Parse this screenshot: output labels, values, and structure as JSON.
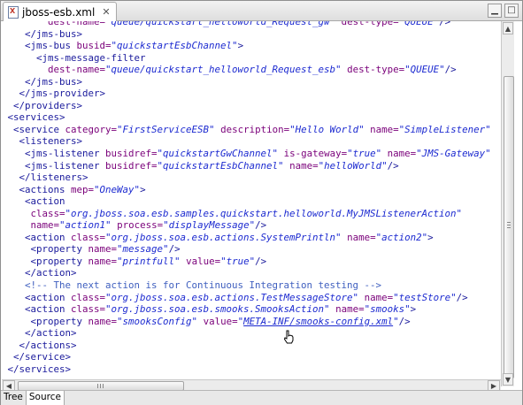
{
  "tab": {
    "title": "jboss-esb.xml",
    "close_glyph": "✕"
  },
  "window_buttons": {
    "minimize": "▁",
    "maximize": "□"
  },
  "bottom_tabs": [
    "Tree",
    "Source"
  ],
  "active_bottom_tab": "Source",
  "code_lines": [
    [
      [
        "t",
        "        "
      ],
      [
        "a",
        "dest-name="
      ],
      [
        "v",
        "\"queue/quickstart_helloworld_Request_gw\""
      ],
      [
        "t",
        " "
      ],
      [
        "a",
        "dest-type="
      ],
      [
        "v",
        "\"QUEUE\""
      ],
      [
        "g",
        "/>"
      ]
    ],
    [
      [
        "t",
        "    "
      ],
      [
        "g",
        "</jms-bus>"
      ]
    ],
    [
      [
        "t",
        "    "
      ],
      [
        "g",
        "<jms-bus "
      ],
      [
        "a",
        "busid="
      ],
      [
        "v",
        "\"quickstartEsbChannel\""
      ],
      [
        "g",
        ">"
      ]
    ],
    [
      [
        "t",
        "      "
      ],
      [
        "g",
        "<jms-message-filter"
      ]
    ],
    [
      [
        "t",
        "        "
      ],
      [
        "a",
        "dest-name="
      ],
      [
        "v",
        "\"queue/quickstart_helloworld_Request_esb\""
      ],
      [
        "t",
        " "
      ],
      [
        "a",
        "dest-type="
      ],
      [
        "v",
        "\"QUEUE\""
      ],
      [
        "g",
        "/>"
      ]
    ],
    [
      [
        "t",
        "    "
      ],
      [
        "g",
        "</jms-bus>"
      ]
    ],
    [
      [
        "t",
        "   "
      ],
      [
        "g",
        "</jms-provider>"
      ]
    ],
    [
      [
        "t",
        "  "
      ],
      [
        "g",
        "</providers>"
      ]
    ],
    [
      [
        "t",
        " "
      ],
      [
        "g",
        "<services>"
      ]
    ],
    [
      [
        "t",
        "  "
      ],
      [
        "g",
        "<service "
      ],
      [
        "a",
        "category="
      ],
      [
        "v",
        "\"FirstServiceESB\""
      ],
      [
        "t",
        " "
      ],
      [
        "a",
        "description="
      ],
      [
        "v",
        "\"Hello World\""
      ],
      [
        "t",
        " "
      ],
      [
        "a",
        "name="
      ],
      [
        "v",
        "\"SimpleListener\""
      ]
    ],
    [
      [
        "t",
        "   "
      ],
      [
        "g",
        "<listeners>"
      ]
    ],
    [
      [
        "t",
        "    "
      ],
      [
        "g",
        "<jms-listener "
      ],
      [
        "a",
        "busidref="
      ],
      [
        "v",
        "\"quickstartGwChannel\""
      ],
      [
        "t",
        " "
      ],
      [
        "a",
        "is-gateway="
      ],
      [
        "v",
        "\"true\""
      ],
      [
        "t",
        " "
      ],
      [
        "a",
        "name="
      ],
      [
        "v",
        "\"JMS-Gateway\""
      ]
    ],
    [
      [
        "t",
        "    "
      ],
      [
        "g",
        "<jms-listener "
      ],
      [
        "a",
        "busidref="
      ],
      [
        "v",
        "\"quickstartEsbChannel\""
      ],
      [
        "t",
        " "
      ],
      [
        "a",
        "name="
      ],
      [
        "v",
        "\"helloWorld\""
      ],
      [
        "g",
        "/>"
      ]
    ],
    [
      [
        "t",
        "   "
      ],
      [
        "g",
        "</listeners>"
      ]
    ],
    [
      [
        "t",
        "   "
      ],
      [
        "g",
        "<actions "
      ],
      [
        "a",
        "mep="
      ],
      [
        "v",
        "\"OneWay\""
      ],
      [
        "g",
        ">"
      ]
    ],
    [
      [
        "t",
        "    "
      ],
      [
        "g",
        "<action"
      ]
    ],
    [
      [
        "t",
        "     "
      ],
      [
        "a",
        "class="
      ],
      [
        "v",
        "\"org.jboss.soa.esb.samples.quickstart.helloworld.MyJMSListenerAction\""
      ]
    ],
    [
      [
        "t",
        "     "
      ],
      [
        "a",
        "name="
      ],
      [
        "v",
        "\"action1\""
      ],
      [
        "t",
        " "
      ],
      [
        "a",
        "process="
      ],
      [
        "v",
        "\"displayMessage\""
      ],
      [
        "g",
        "/>"
      ]
    ],
    [
      [
        "t",
        "    "
      ],
      [
        "g",
        "<action "
      ],
      [
        "a",
        "class="
      ],
      [
        "v",
        "\"org.jboss.soa.esb.actions.SystemPrintln\""
      ],
      [
        "t",
        " "
      ],
      [
        "a",
        "name="
      ],
      [
        "v",
        "\"action2\""
      ],
      [
        "g",
        ">"
      ]
    ],
    [
      [
        "t",
        "     "
      ],
      [
        "g",
        "<property "
      ],
      [
        "a",
        "name="
      ],
      [
        "v",
        "\"message\""
      ],
      [
        "g",
        "/>"
      ]
    ],
    [
      [
        "t",
        "     "
      ],
      [
        "g",
        "<property "
      ],
      [
        "a",
        "name="
      ],
      [
        "v",
        "\"printfull\""
      ],
      [
        "t",
        " "
      ],
      [
        "a",
        "value="
      ],
      [
        "v",
        "\"true\""
      ],
      [
        "g",
        "/>"
      ]
    ],
    [
      [
        "t",
        "    "
      ],
      [
        "g",
        "</action>"
      ]
    ],
    [
      [
        "t",
        "    "
      ],
      [
        "c",
        "<!-- The next action is for Continuous Integration testing -->"
      ]
    ],
    [
      [
        "t",
        "    "
      ],
      [
        "g",
        "<action "
      ],
      [
        "a",
        "class="
      ],
      [
        "v",
        "\"org.jboss.soa.esb.actions.TestMessageStore\""
      ],
      [
        "t",
        " "
      ],
      [
        "a",
        "name="
      ],
      [
        "v",
        "\"testStore\""
      ],
      [
        "g",
        "/>"
      ]
    ],
    [
      [
        "t",
        "    "
      ],
      [
        "g",
        "<action "
      ],
      [
        "a",
        "class="
      ],
      [
        "v",
        "\"org.jboss.soa.esb.smooks.SmooksAction\""
      ],
      [
        "t",
        " "
      ],
      [
        "a",
        "name="
      ],
      [
        "v",
        "\"smooks\""
      ],
      [
        "g",
        ">"
      ]
    ],
    [
      [
        "t",
        "     "
      ],
      [
        "g",
        "<property "
      ],
      [
        "a",
        "name="
      ],
      [
        "v",
        "\"smooksConfig\""
      ],
      [
        "t",
        " "
      ],
      [
        "a",
        "value="
      ],
      [
        "v",
        "\""
      ],
      [
        "l",
        "META-INF/smooks-config.xml"
      ],
      [
        "v",
        "\""
      ],
      [
        "g",
        "/>"
      ]
    ],
    [
      [
        "t",
        "    "
      ],
      [
        "g",
        "</action>"
      ]
    ],
    [
      [
        "t",
        "   "
      ],
      [
        "g",
        "</actions>"
      ]
    ],
    [
      [
        "t",
        "  "
      ],
      [
        "g",
        "</service>"
      ]
    ],
    [
      [
        "t",
        " "
      ],
      [
        "g",
        "</services>"
      ]
    ]
  ]
}
